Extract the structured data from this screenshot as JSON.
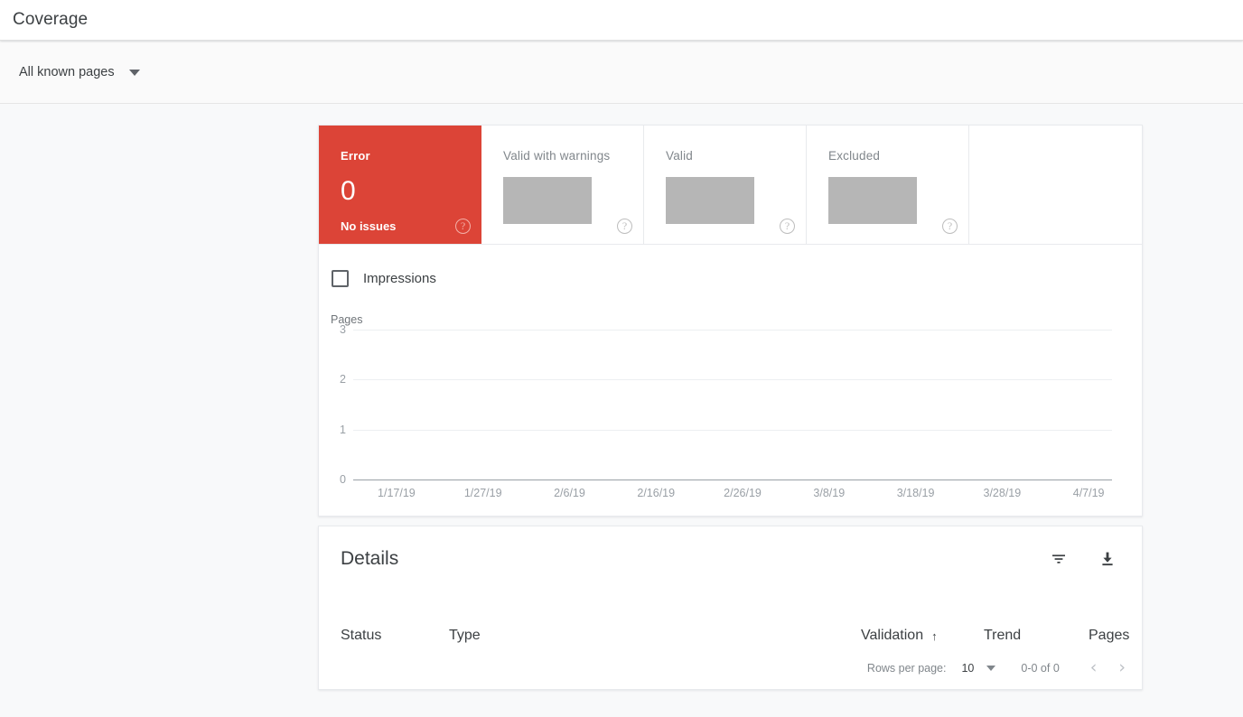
{
  "header": {
    "title": "Coverage"
  },
  "filter_bar": {
    "scope_label": "All known pages",
    "caret_icon": "chevron-down-icon"
  },
  "status_cards": [
    {
      "name": "Error",
      "count": "0",
      "sub": "No issues",
      "state": "error",
      "color": "#dc4437",
      "help_icon": "help-circle-icon",
      "loading": false
    },
    {
      "name": "Valid with warnings",
      "state": "default",
      "help_icon": "help-circle-icon",
      "loading": true
    },
    {
      "name": "Valid",
      "state": "default",
      "help_icon": "help-circle-icon",
      "loading": true
    },
    {
      "name": "Excluded",
      "state": "default",
      "help_icon": "help-circle-icon",
      "loading": true
    }
  ],
  "chart_panel": {
    "legend": {
      "impressions_label": "Impressions",
      "impressions_checked": false
    }
  },
  "chart_data": {
    "type": "line",
    "title": "",
    "ylabel": "Pages",
    "xlabel": "",
    "ylim": [
      0,
      3
    ],
    "yticks": [
      "3",
      "2",
      "1",
      "0"
    ],
    "grid": true,
    "legend_position": "top-left",
    "categories": [
      "1/17/19",
      "1/27/19",
      "2/6/19",
      "2/16/19",
      "2/26/19",
      "3/8/19",
      "3/18/19",
      "3/28/19",
      "4/7/19"
    ],
    "series": [
      {
        "name": "Pages",
        "values": [
          0,
          0,
          0,
          0,
          0,
          0,
          0,
          0,
          0
        ]
      }
    ]
  },
  "details": {
    "title": "Details",
    "filter_icon": "filter-icon",
    "download_icon": "download-icon",
    "columns": [
      {
        "key": "status",
        "label": "Status",
        "sorted": false
      },
      {
        "key": "type",
        "label": "Type",
        "sorted": false
      },
      {
        "key": "validation",
        "label": "Validation",
        "sorted": true,
        "sort_arrow": "↑"
      },
      {
        "key": "trend",
        "label": "Trend",
        "sorted": false
      },
      {
        "key": "pages",
        "label": "Pages",
        "sorted": false
      }
    ],
    "rows": [],
    "pagination": {
      "rows_per_page_label": "Rows per page:",
      "rows_per_page_value": "10",
      "range_label": "0-0 of 0",
      "prev_icon": "chevron-left-icon",
      "next_icon": "chevron-right-icon"
    }
  }
}
